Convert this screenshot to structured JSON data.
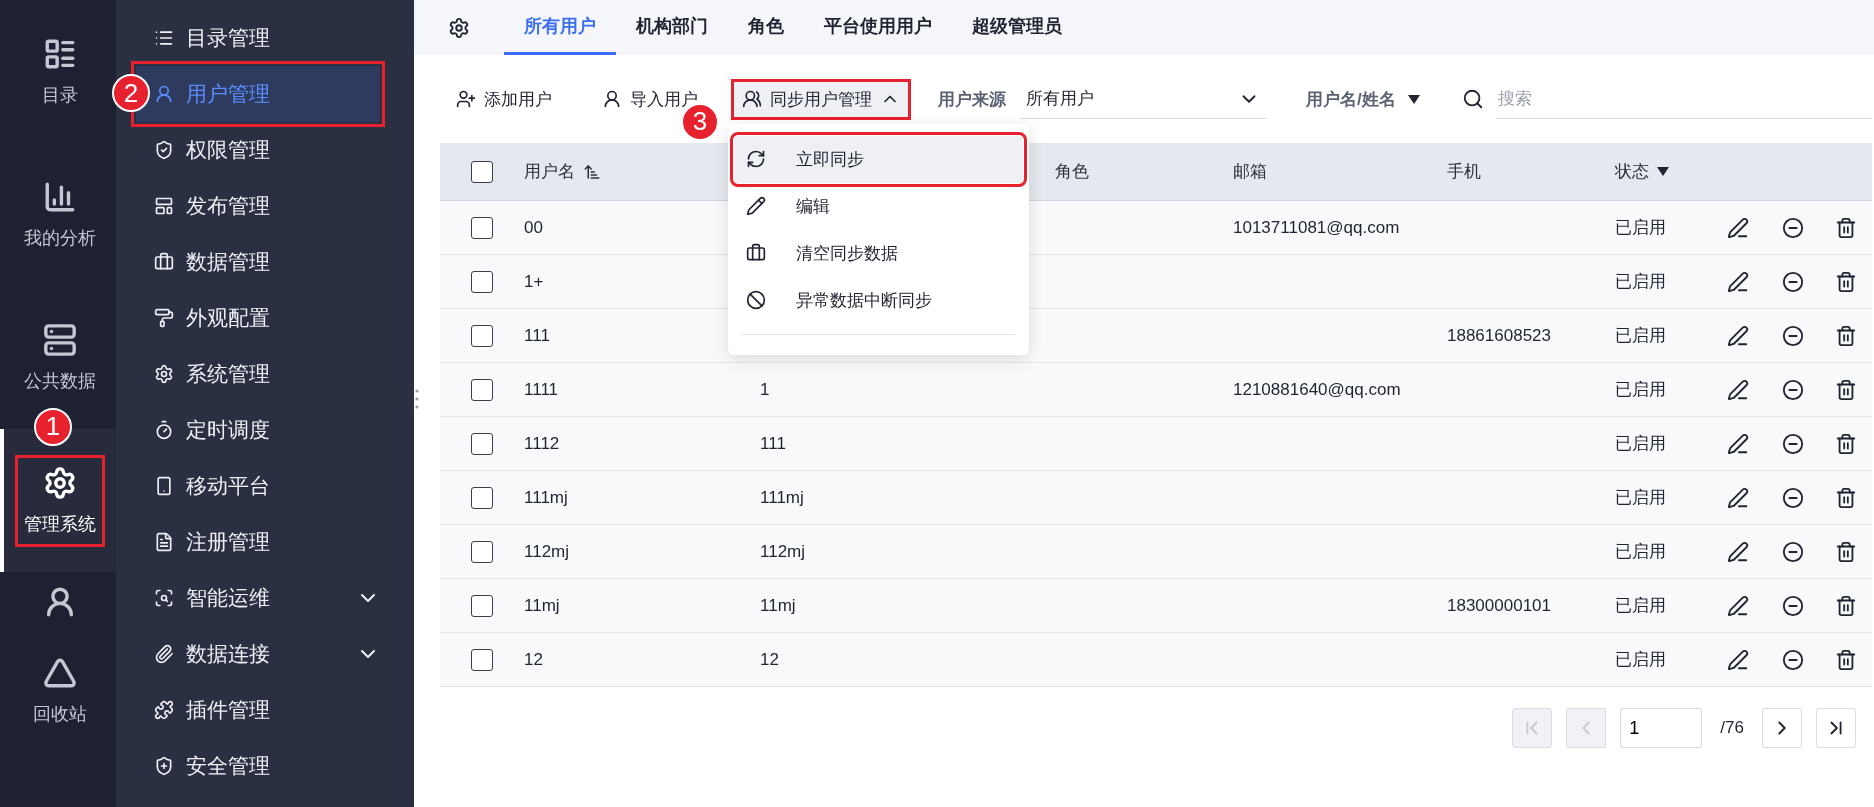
{
  "rail": [
    {
      "label": "目录",
      "selected": false,
      "highlighted": false
    },
    {
      "label": "我的分析",
      "selected": false,
      "highlighted": false
    },
    {
      "label": "公共数据",
      "selected": false,
      "highlighted": false
    },
    {
      "label": "管理系统",
      "selected": true,
      "highlighted": true,
      "callout": "1"
    },
    {
      "selected": false,
      "highlighted": false
    },
    {
      "label": "回收站",
      "selected": false,
      "highlighted": false
    }
  ],
  "nav": [
    {
      "label": "目录管理",
      "selected": false,
      "highlighted": false
    },
    {
      "label": "用户管理",
      "selected": true,
      "highlighted": true,
      "callout": "2"
    },
    {
      "label": "权限管理",
      "selected": false,
      "highlighted": false
    },
    {
      "label": "发布管理",
      "selected": false,
      "highlighted": false
    },
    {
      "label": "数据管理",
      "selected": false,
      "highlighted": false
    },
    {
      "label": "外观配置",
      "selected": false,
      "highlighted": false
    },
    {
      "label": "系统管理",
      "selected": false,
      "highlighted": false
    },
    {
      "label": "定时调度",
      "selected": false,
      "highlighted": false
    },
    {
      "label": "移动平台",
      "selected": false,
      "highlighted": false
    },
    {
      "label": "注册管理",
      "selected": false,
      "highlighted": false
    },
    {
      "label": "智能运维",
      "selected": false,
      "highlighted": false,
      "expanded": false
    },
    {
      "label": "数据连接",
      "selected": false,
      "highlighted": false,
      "expanded": false
    },
    {
      "label": "插件管理",
      "selected": false,
      "highlighted": false
    },
    {
      "label": "安全管理",
      "selected": false,
      "highlighted": false
    }
  ],
  "tabs": [
    {
      "label": "所有用户",
      "selected": true
    },
    {
      "label": "机构部门",
      "selected": false
    },
    {
      "label": "角色",
      "selected": false
    },
    {
      "label": "平台使用用户",
      "selected": false
    },
    {
      "label": "超级管理员",
      "selected": false
    }
  ],
  "toolbar": {
    "add_button": "添加用户",
    "import_button": "导入用户",
    "sync_button": {
      "label": "同步用户管理",
      "expanded": true,
      "highlighted": true,
      "callout": "3"
    },
    "source_label": "用户来源",
    "source_select": "所有用户",
    "search_by": "用户名/姓名",
    "search": {
      "placeholder": "搜索"
    }
  },
  "sync_menu": [
    {
      "label": "立即同步",
      "selected": true,
      "highlighted": true
    },
    {
      "label": "编辑",
      "selected": false,
      "highlighted": false
    },
    {
      "label": "清空同步数据",
      "selected": false,
      "highlighted": false
    },
    {
      "label": "异常数据中断同步",
      "selected": false,
      "highlighted": false
    }
  ],
  "table": {
    "header": {
      "checked": false,
      "username": "用户名",
      "role": "角色",
      "email": "邮箱",
      "phone": "手机",
      "status": "状态"
    },
    "rows": [
      {
        "checked": false,
        "username": "00",
        "email": "1013711081@qq.com",
        "status": "已启用"
      },
      {
        "checked": false,
        "username": "1+",
        "status": "已启用"
      },
      {
        "checked": false,
        "username": "111",
        "phone": "18861608523",
        "status": "已启用"
      },
      {
        "checked": false,
        "username": "1111",
        "column_2": "1",
        "email": "1210881640@qq.com",
        "status": "已启用"
      },
      {
        "checked": false,
        "username": "1112",
        "column_2": "111",
        "status": "已启用"
      },
      {
        "checked": false,
        "username": "111mj",
        "column_2": "111mj",
        "status": "已启用"
      },
      {
        "checked": false,
        "username": "112mj",
        "column_2": "112mj",
        "status": "已启用"
      },
      {
        "checked": false,
        "username": "11mj",
        "column_2": "11mj",
        "phone": "18300000101",
        "status": "已启用"
      },
      {
        "checked": false,
        "username": "12",
        "column_2": "12",
        "status": "已启用"
      }
    ]
  },
  "pagination": {
    "page": "1",
    "total": "/76",
    "first_disabled": true,
    "prev_disabled": true
  }
}
